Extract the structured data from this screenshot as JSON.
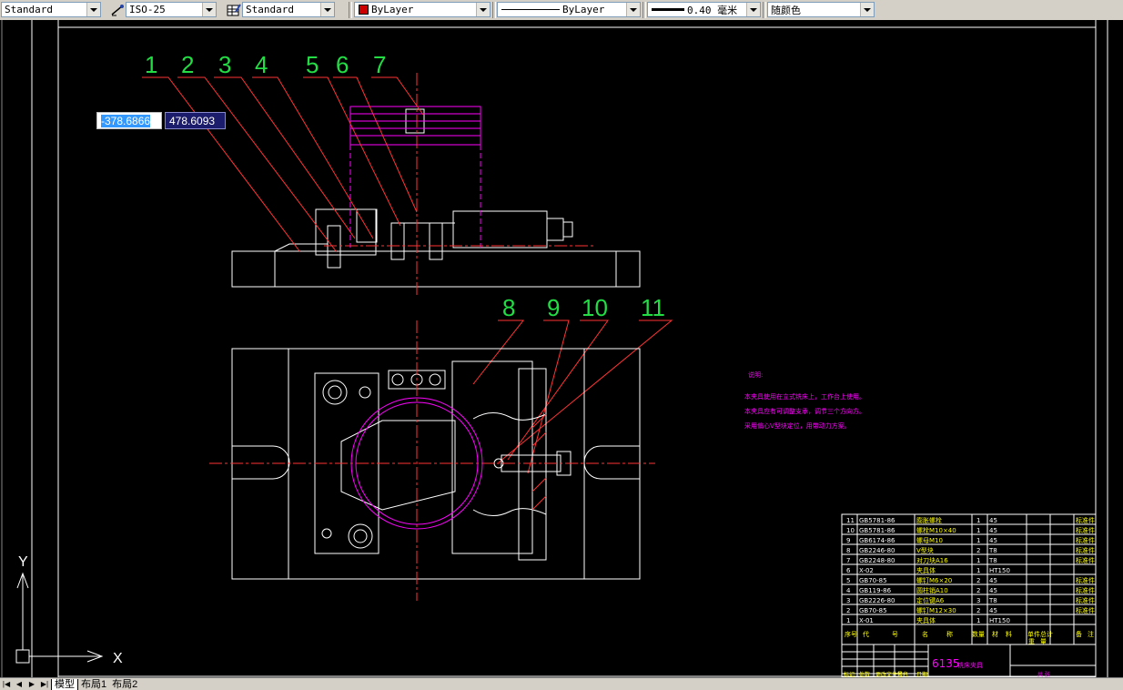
{
  "toolbar": {
    "text_style": "Standard",
    "dim_style": "ISO-25",
    "table_style": "Standard",
    "layer_color": "ByLayer",
    "linetype": "ByLayer",
    "lineweight": "0.40 毫米",
    "plot_style": "随颜色",
    "colors": {
      "layer_swatch": "#cc0000"
    }
  },
  "dynamic_input": {
    "x": "-378.6866",
    "y": "478.6093"
  },
  "balloons": [
    "1",
    "2",
    "3",
    "4",
    "5",
    "6",
    "7",
    "8",
    "9",
    "10",
    "11"
  ],
  "notes": {
    "heading": "说明:",
    "lines": [
      "本夹具使用在立式铣床上，工作台上使用。",
      "本夹具应有可调整支承，调节三个方向方。",
      "采用偏心V型块定位，用带动力方案。"
    ]
  },
  "bom": {
    "rows": [
      {
        "no": "11",
        "code": "GB5781-86",
        "name": "膨胀螺栓",
        "qty": "1",
        "mat": "45",
        "note": "标准件"
      },
      {
        "no": "10",
        "code": "GB5781-86",
        "name": "螺栓M10×40",
        "qty": "1",
        "mat": "45",
        "note": "标准件"
      },
      {
        "no": "9",
        "code": "GB6174-86",
        "name": "螺母M10",
        "qty": "1",
        "mat": "45",
        "note": "标准件"
      },
      {
        "no": "8",
        "code": "GB2246-80",
        "name": "V型块",
        "qty": "2",
        "mat": "T8",
        "note": "标准件"
      },
      {
        "no": "7",
        "code": "GB2248-80",
        "name": "对刀块A16",
        "qty": "1",
        "mat": "T8",
        "note": "标准件"
      },
      {
        "no": "6",
        "code": "X-02",
        "name": "夹具体",
        "qty": "1",
        "mat": "HT150",
        "note": ""
      },
      {
        "no": "5",
        "code": "GB70-85",
        "name": "螺钉M6×20",
        "qty": "2",
        "mat": "45",
        "note": "标准件"
      },
      {
        "no": "4",
        "code": "GB119-86",
        "name": "圆柱销A10",
        "qty": "2",
        "mat": "45",
        "note": "标准件"
      },
      {
        "no": "3",
        "code": "GB2226-80",
        "name": "定位键A6",
        "qty": "3",
        "mat": "T8",
        "note": "标准件"
      },
      {
        "no": "2",
        "code": "GB70-85",
        "name": "螺钉M12×30",
        "qty": "2",
        "mat": "45",
        "note": "标准件"
      },
      {
        "no": "1",
        "code": "X-01",
        "name": "夹具体",
        "qty": "1",
        "mat": "HT150",
        "note": ""
      }
    ],
    "header": [
      "序号",
      "代",
      "号",
      "名",
      "称",
      "数量",
      "材",
      "料",
      "单件",
      "总计",
      "重",
      "量",
      "备",
      "注"
    ],
    "title_block": {
      "drawing_name": "6135",
      "subtitle": "铣床夹具",
      "footer_left": [
        "标记",
        "处数",
        "更改文件号",
        "签名",
        "日期"
      ],
      "footer_right": "共 张"
    }
  },
  "ucs": {
    "x_label": "X",
    "y_label": "Y"
  },
  "tabs": {
    "model": "模型",
    "layout1": "布局1",
    "layout2": "布局2"
  }
}
